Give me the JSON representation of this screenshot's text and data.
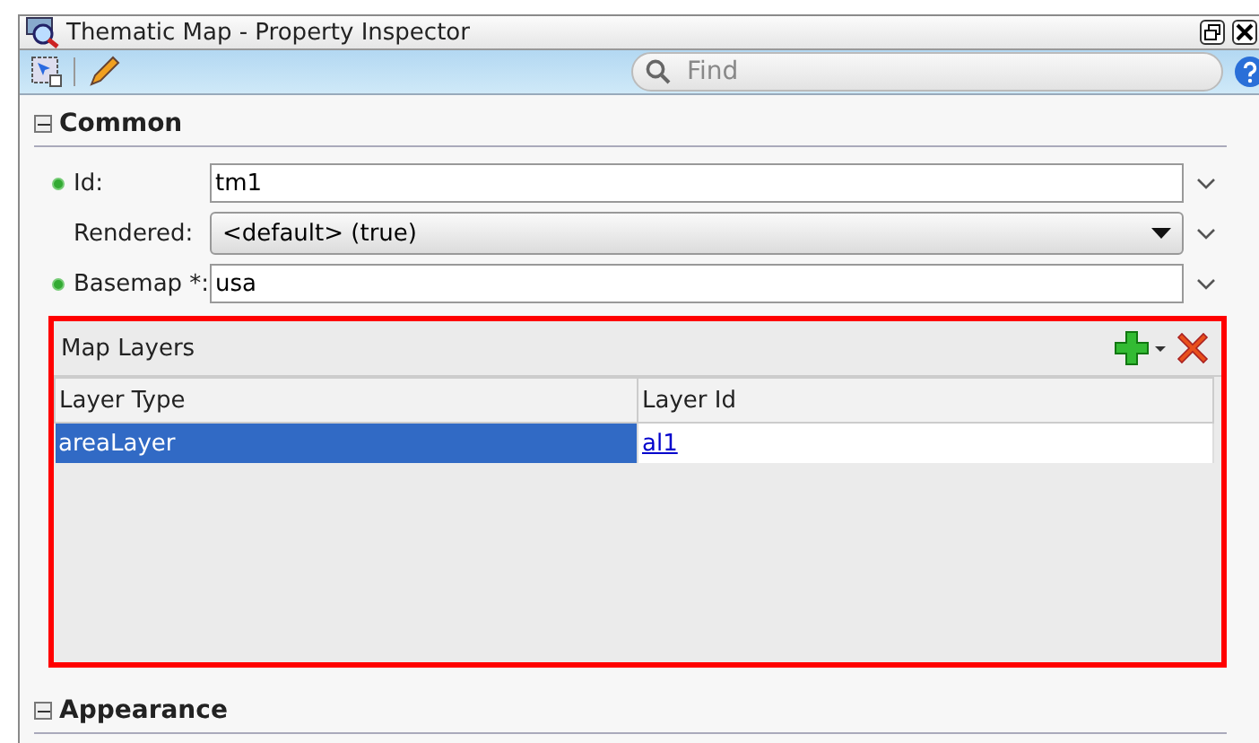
{
  "window": {
    "title": "Thematic Map - Property Inspector"
  },
  "search": {
    "placeholder": "Find"
  },
  "sections": [
    {
      "title": "Common",
      "expanded": true,
      "fields": [
        {
          "label": "Id:",
          "kind": "text",
          "required": true,
          "value": "tm1"
        },
        {
          "label": "Rendered:",
          "kind": "select",
          "required": false,
          "value": "<default> (true)"
        },
        {
          "label": "Basemap *:",
          "kind": "text",
          "required": true,
          "value": "usa"
        }
      ],
      "layers": {
        "title": "Map Layers",
        "highlighted": true,
        "columns": [
          "Layer Type",
          "Layer Id"
        ],
        "rows": [
          {
            "selected": true,
            "cells": [
              "areaLayer",
              "al1"
            ]
          }
        ]
      }
    },
    {
      "title": "Appearance",
      "expanded": true
    }
  ]
}
